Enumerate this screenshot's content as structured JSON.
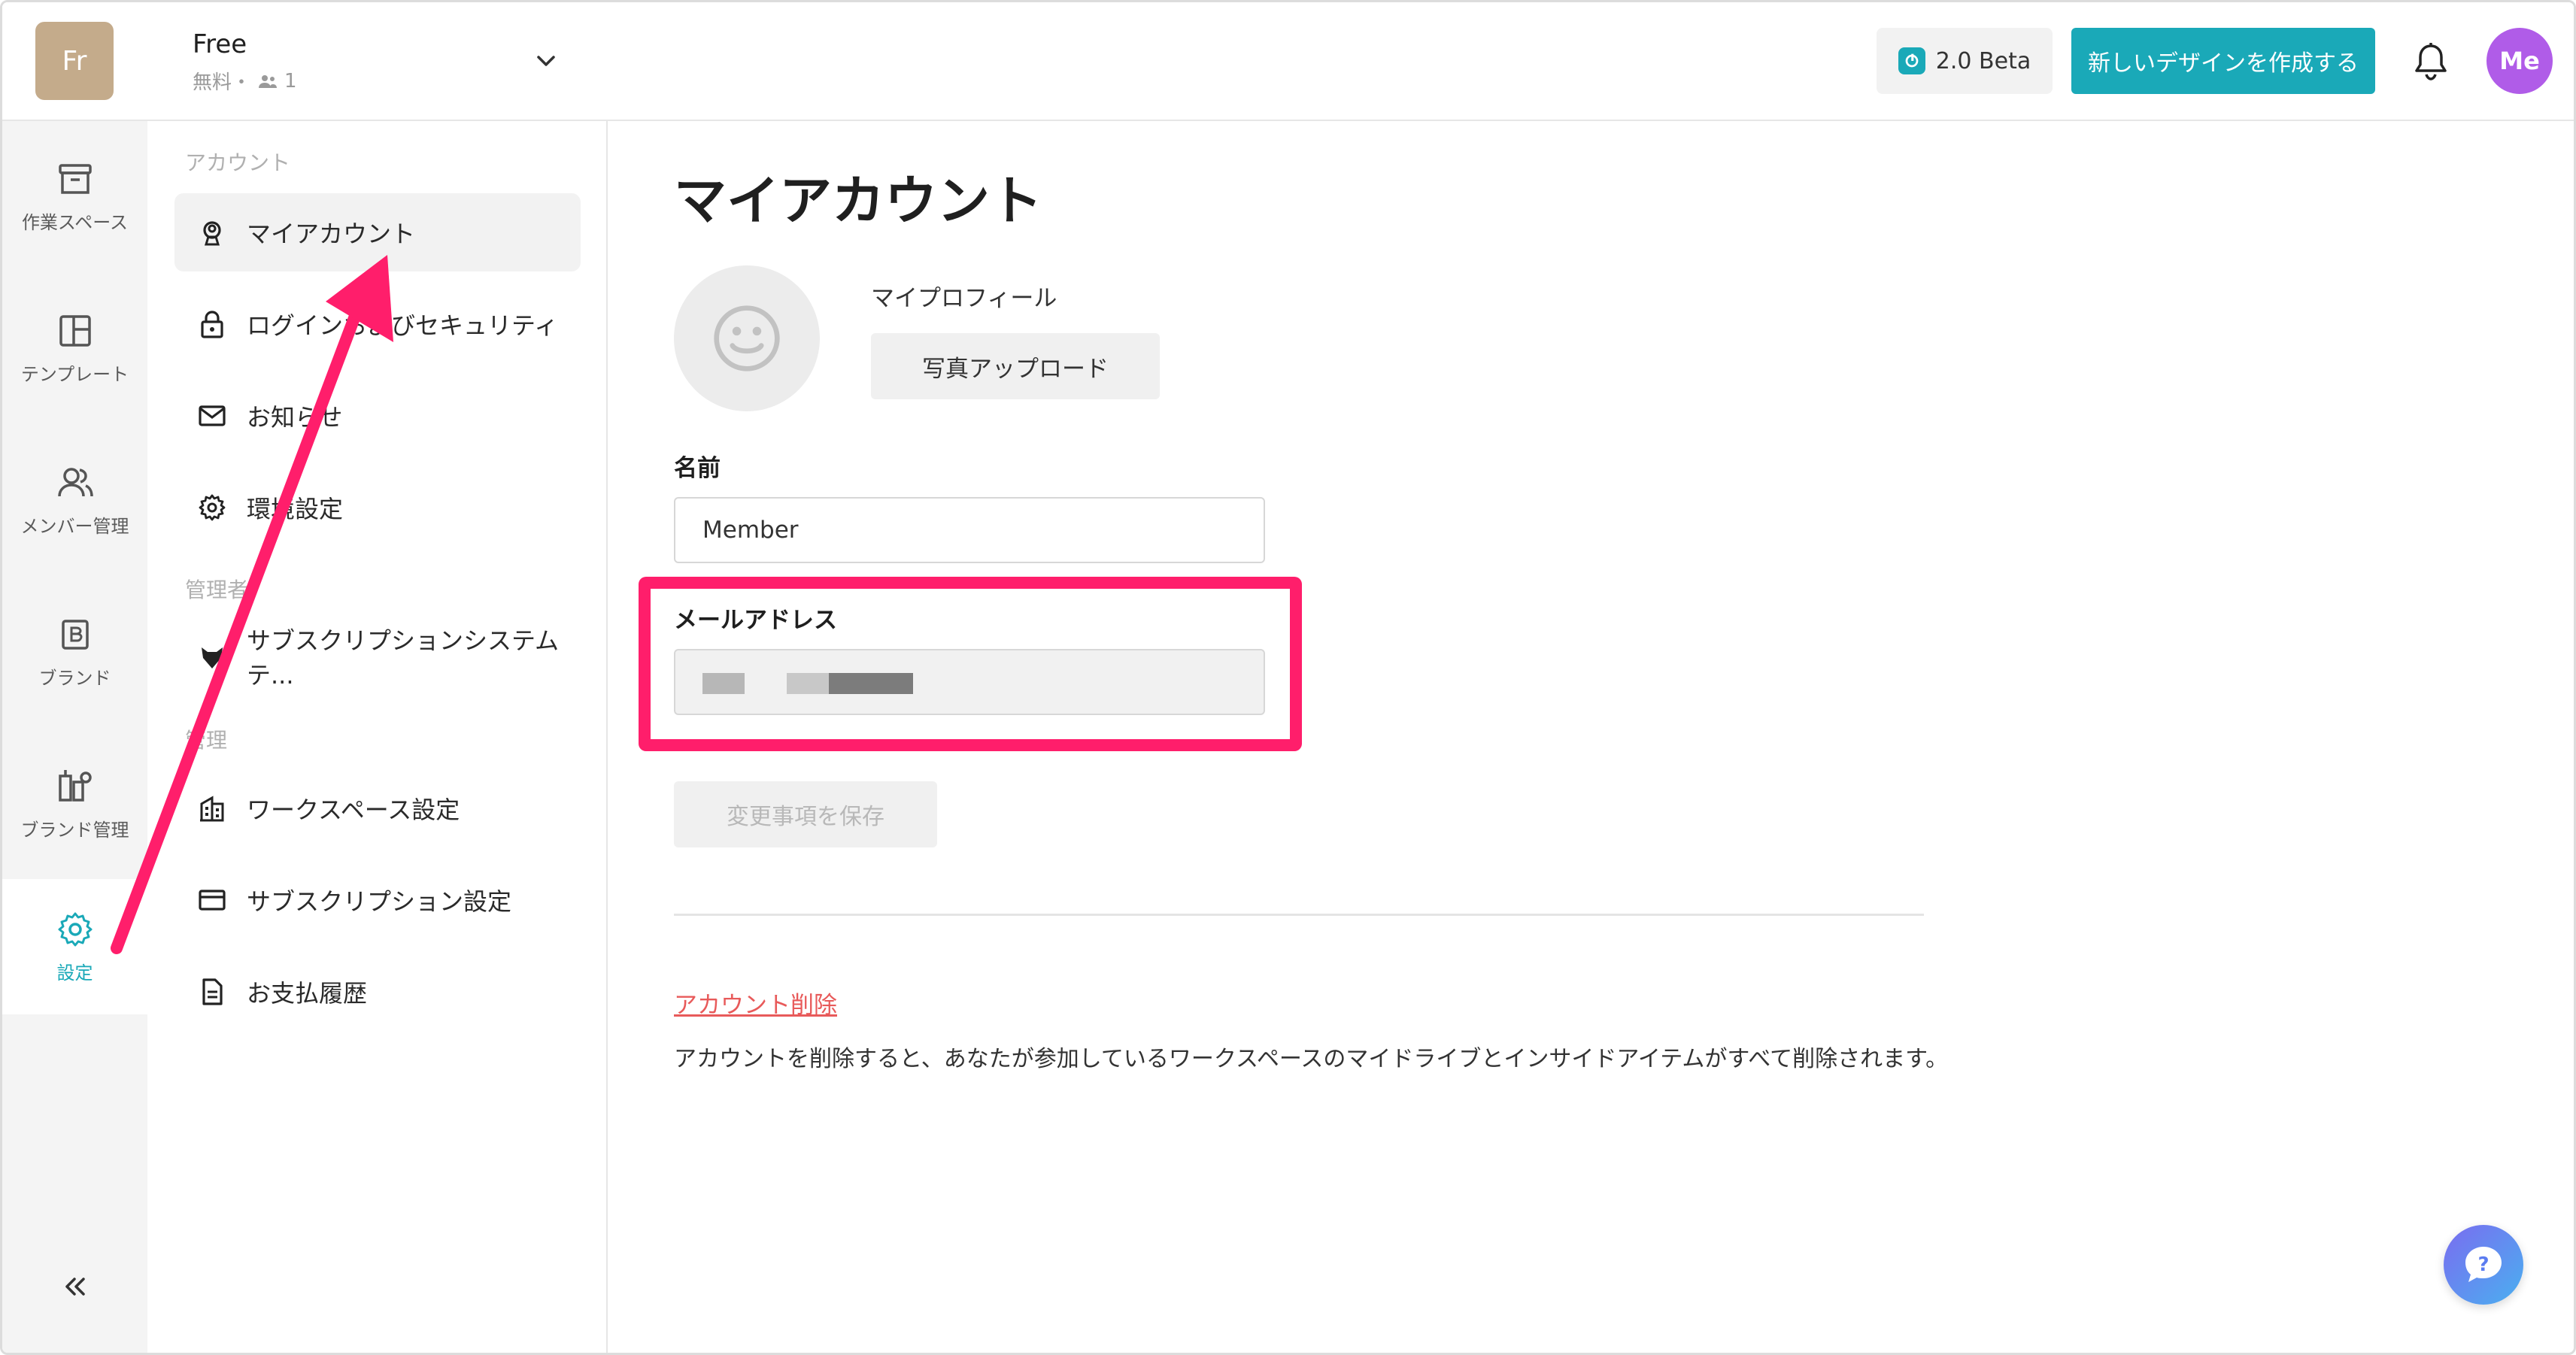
{
  "header": {
    "workspace_avatar": "Fr",
    "workspace_name": "Free",
    "workspace_plan": "無料・",
    "member_count": "1",
    "beta_label": "2.0 Beta",
    "create_label": "新しいデザインを作成する",
    "user_avatar": "Me"
  },
  "rail": {
    "items": [
      {
        "label": "作業スペース",
        "icon": "archive-icon"
      },
      {
        "label": "テンプレート",
        "icon": "template-icon"
      },
      {
        "label": "メンバー管理",
        "icon": "members-icon"
      },
      {
        "label": "ブランド",
        "icon": "brand-icon"
      },
      {
        "label": "ブランド管理",
        "icon": "brand-manage-icon"
      },
      {
        "label": "設定",
        "icon": "gear-icon"
      }
    ],
    "active": "設定",
    "accent": "#1aa9b8"
  },
  "menu": {
    "section_account": "アカウント",
    "items_account": [
      {
        "label": "マイアカウント",
        "icon": "user-badge-icon"
      },
      {
        "label": "ログインおよびセキュリティ",
        "icon": "lock-icon"
      },
      {
        "label": "お知らせ",
        "icon": "mail-icon"
      },
      {
        "label": "環境設定",
        "icon": "gear-icon"
      }
    ],
    "section_admin": "管理者",
    "items_admin": [
      {
        "label": "サブスクリプションシステムテ...",
        "icon": "fox-icon"
      }
    ],
    "section_manage": "管理",
    "items_manage": [
      {
        "label": "ワークスペース設定",
        "icon": "building-icon"
      },
      {
        "label": "サブスクリプション設定",
        "icon": "card-icon"
      },
      {
        "label": "お支払履歴",
        "icon": "document-icon"
      }
    ]
  },
  "main": {
    "title": "マイアカウント",
    "profile_label": "マイプロフィール",
    "upload_label": "写真アップロード",
    "name_label": "名前",
    "name_value": "Member",
    "email_label": "メールアドレス",
    "save_label": "変更事項を保存",
    "delete_link": "アカウント削除",
    "delete_desc": "アカウントを削除すると、あなたが参加しているワークスペースのマイドライブとインサイドアイテムがすべて削除されます。"
  },
  "colors": {
    "accent": "#1aa9b8",
    "highlight": "#ff1e6b",
    "danger": "#e85a5a",
    "user_avatar": "#b05ce8",
    "workspace_avatar": "#c4ab8b"
  }
}
